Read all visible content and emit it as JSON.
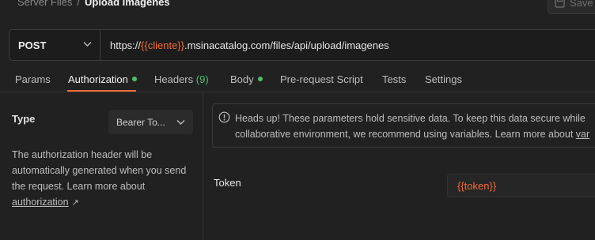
{
  "header": {
    "breadcrumb_parent": "Server Files",
    "breadcrumb_separator": "/",
    "breadcrumb_current": "Upload Imagenes",
    "save_label": "Save"
  },
  "request": {
    "method": "POST",
    "url_prefix": "https://",
    "url_var": "{{cliente}}",
    "url_suffix": ".msinacatalog.com/files/api/upload/imagenes"
  },
  "tabs": [
    {
      "label": "Params"
    },
    {
      "label": "Authorization"
    },
    {
      "label": "Headers",
      "count": "(9)"
    },
    {
      "label": "Body"
    },
    {
      "label": "Pre-request Script"
    },
    {
      "label": "Tests"
    },
    {
      "label": "Settings"
    }
  ],
  "auth": {
    "type_label": "Type",
    "type_value": "Bearer To...",
    "desc_text": "The authorization header will be automatically generated when you send the request. Learn more about",
    "desc_link": "authorization",
    "alert_line1": "Heads up! These parameters hold sensitive data. To keep this data secure while",
    "alert_line2_text": "collaborative environment, we recommend using variables. Learn more about",
    "alert_line2_link": "var",
    "token_label": "Token",
    "token_value": "{{token}}"
  },
  "colors": {
    "accent": "#f26b3a",
    "status_green": "#4cbe6c",
    "background": "#212121"
  }
}
